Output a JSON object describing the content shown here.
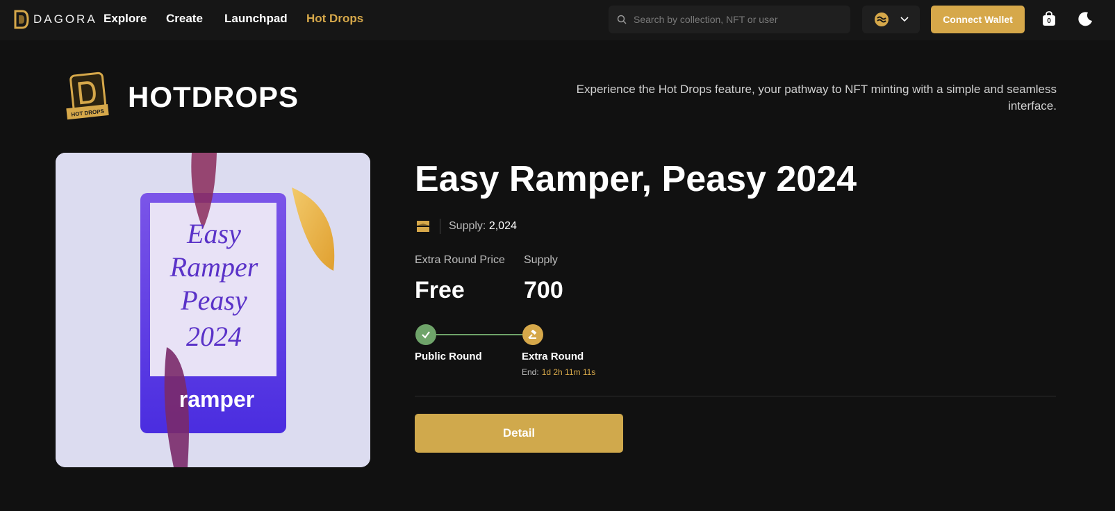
{
  "nav": {
    "logo_text": "DAGORA",
    "links": [
      "Explore",
      "Create",
      "Launchpad",
      "Hot Drops"
    ],
    "search_placeholder": "Search by collection, NFT or user",
    "connect_label": "Connect Wallet",
    "bag_count": "0"
  },
  "header": {
    "title": "HOTDROPS",
    "badge_text": "HOT DROPS",
    "description": "Experience the Hot Drops feature, your pathway to NFT minting with a simple and seamless interface."
  },
  "artwork": {
    "text_lines": [
      "Easy",
      "Ramper",
      "Peasy",
      "2024"
    ],
    "brand": "ramper"
  },
  "drop": {
    "title": "Easy Ramper, Peasy 2024",
    "supply_label": "Supply:",
    "supply_value": "2,024",
    "price_label": "Extra Round Price",
    "price_value": "Free",
    "round_supply_label": "Supply",
    "round_supply_value": "700",
    "rounds": [
      {
        "label": "Public Round",
        "status": "completed"
      },
      {
        "label": "Extra Round",
        "status": "active"
      }
    ],
    "end_label": "End:",
    "end_timer": "1d 2h 11m 11s",
    "detail_label": "Detail"
  },
  "colors": {
    "accent": "#d6a84a",
    "success": "#6fa46a",
    "background": "#111111"
  }
}
